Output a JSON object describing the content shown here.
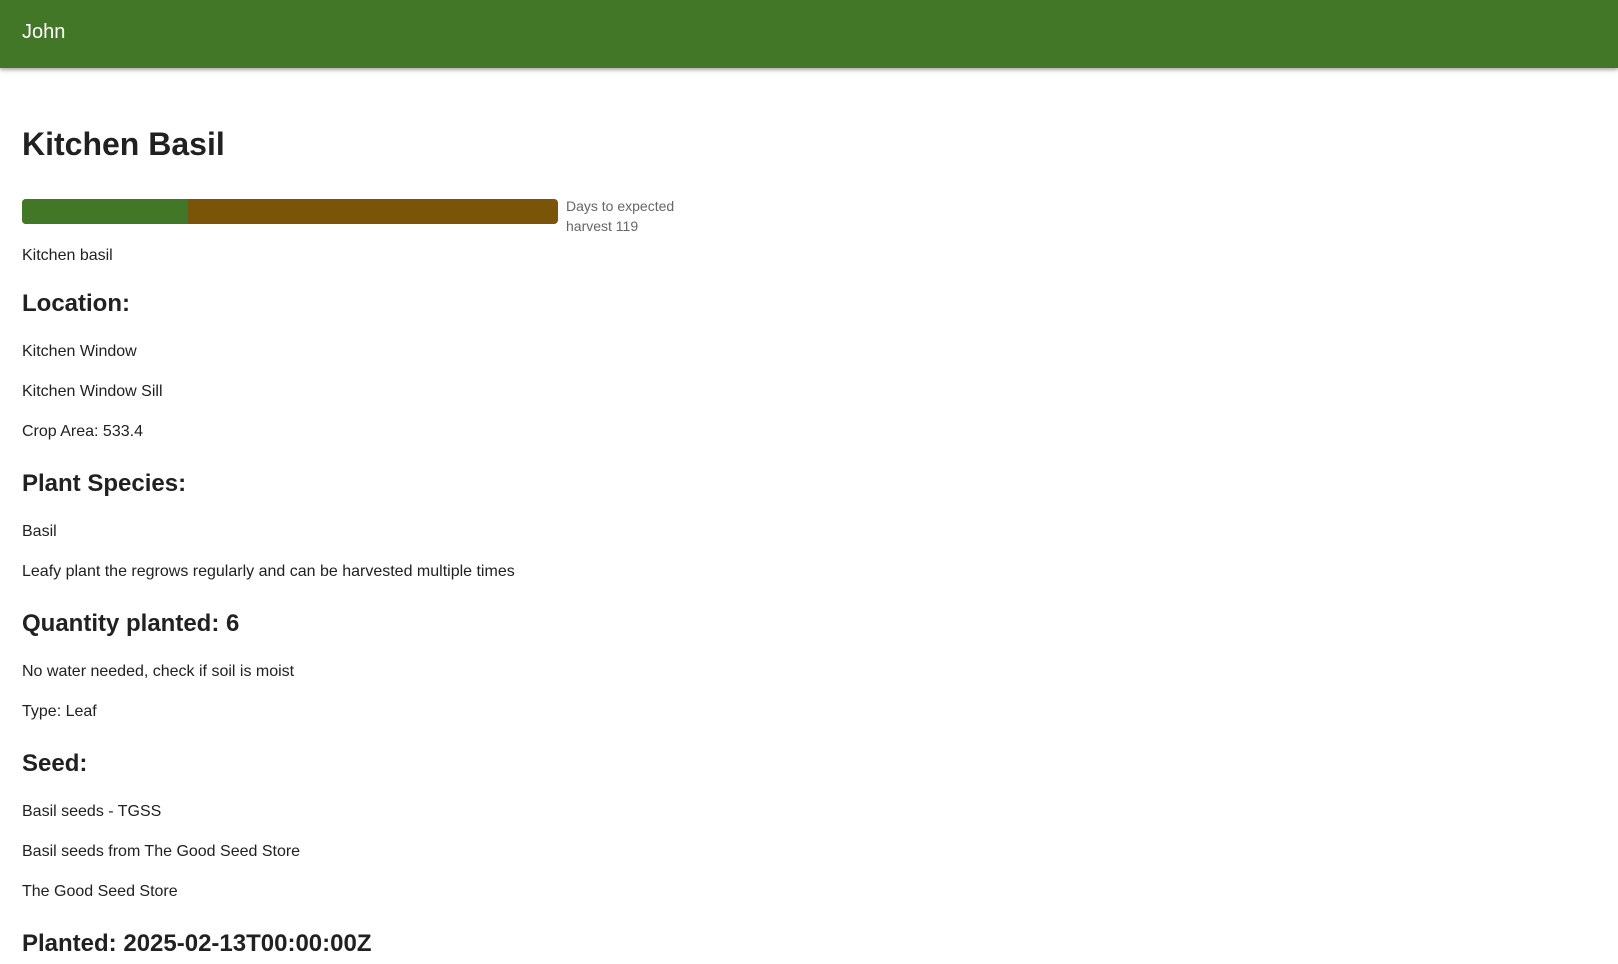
{
  "header": {
    "user_name": "John"
  },
  "crop": {
    "title": "Kitchen Basil",
    "progress": {
      "fraction_elapsed": 0.31,
      "caption": "Days to expected harvest 119"
    },
    "description": "Kitchen basil"
  },
  "location": {
    "heading": "Location:",
    "name": "Kitchen Window",
    "sub_location": "Kitchen Window Sill",
    "crop_area": "Crop Area: 533.4"
  },
  "species": {
    "heading": "Plant Species:",
    "name": "Basil",
    "description": "Leafy plant the regrows regularly and can be harvested multiple times"
  },
  "quantity": {
    "heading": "Quantity planted: 6",
    "water_note": "No water needed, check if soil is moist",
    "type": "Type: Leaf"
  },
  "seed": {
    "heading": "Seed:",
    "name": "Basil seeds - TGSS",
    "description": "Basil seeds from The Good Seed Store",
    "store": "The Good Seed Store"
  },
  "planted": {
    "heading": "Planted: 2025-02-13T00:00:00Z"
  },
  "colors": {
    "header_green": "#417726",
    "progress_green": "#417726",
    "progress_brown": "#7a5407"
  }
}
